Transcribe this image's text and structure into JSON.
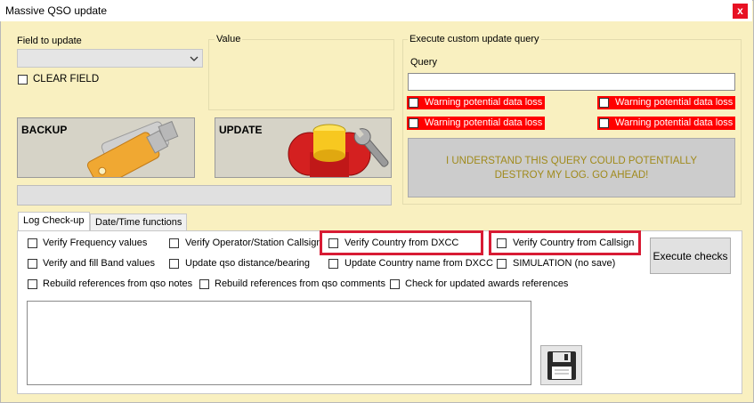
{
  "window": {
    "title": "Massive QSO update",
    "close_label": "x"
  },
  "field_group": {
    "label": "Field to update",
    "selected": "",
    "clear_label": "CLEAR FIELD"
  },
  "value_group": {
    "label": "Value"
  },
  "query_group": {
    "label": "Execute custom update query",
    "query_label": "Query",
    "query_value": "",
    "warnings": [
      "Warning potential data loss",
      "Warning potential data loss",
      "Warning potential data loss",
      "Warning potential data loss"
    ],
    "confirm_label": "I UNDERSTAND THIS QUERY COULD POTENTIALLY DESTROY MY LOG. GO AHEAD!"
  },
  "buttons": {
    "backup": "BACKUP",
    "update": "UPDATE"
  },
  "tabs": [
    {
      "label": "Log Check-up",
      "active": true
    },
    {
      "label": "Date/Time functions",
      "active": false
    }
  ],
  "checks": {
    "verify_frequency": "Verify Frequency values",
    "verify_operator": "Verify Operator/Station Callsign",
    "verify_country_dxcc": "Verify Country from DXCC",
    "verify_country_callsign": "Verify Country from Callsign",
    "verify_band": "Verify and fill Band values",
    "update_distance": "Update qso distance/bearing",
    "update_country_name": "Update Country name from DXCC",
    "simulation": "SIMULATION (no save)",
    "rebuild_notes": "Rebuild references from qso notes",
    "rebuild_comments": "Rebuild references from qso comments",
    "check_awards": "Check for updated awards references"
  },
  "execute_checks": "Execute checks",
  "colors": {
    "background": "#f9f0c0",
    "warning": "#ff0000",
    "highlight": "#d81b34",
    "confirm_text": "#a08a1c"
  }
}
